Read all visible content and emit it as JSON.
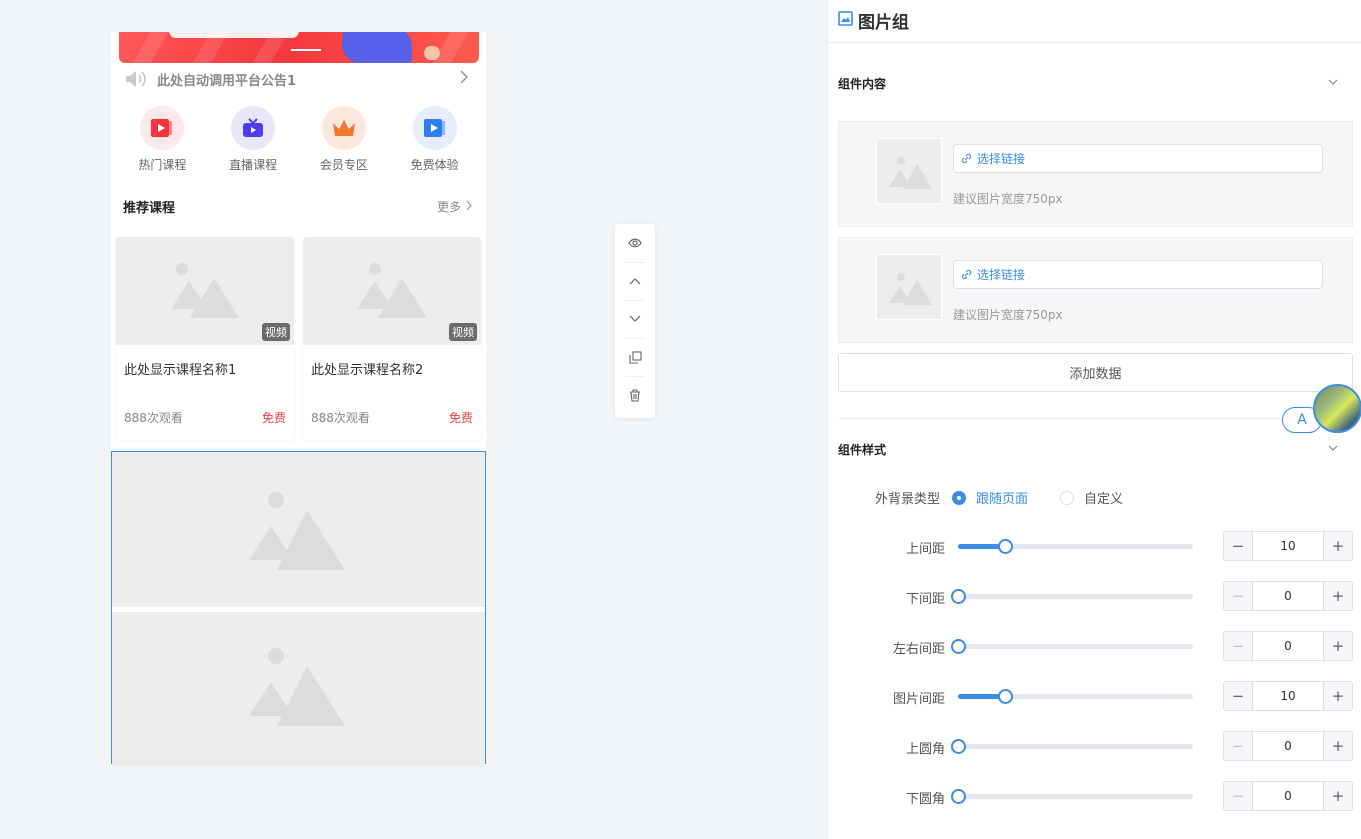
{
  "preview": {
    "notice": {
      "text": "此处自动调用平台公告1"
    },
    "icons": [
      {
        "label": "热门课程",
        "icon": "play-icon",
        "bg": "#fde8ea",
        "color": "#f2333e"
      },
      {
        "label": "直播课程",
        "icon": "tv-icon",
        "bg": "#e8e6fb",
        "color": "#4c3df2"
      },
      {
        "label": "会员专区",
        "icon": "crown-icon",
        "bg": "#fde9dc",
        "color": "#f07a2f"
      },
      {
        "label": "免费体验",
        "icon": "play-icon",
        "bg": "#e4edfb",
        "color": "#2f7ef0"
      }
    ],
    "recommend": {
      "title": "推荐课程",
      "more": "更多"
    },
    "courses": [
      {
        "tag": "视频",
        "name": "此处显示课程名称1",
        "views": "888次观看",
        "price": "免费"
      },
      {
        "tag": "视频",
        "name": "此处显示课程名称2",
        "views": "888次观看",
        "price": "免费"
      }
    ]
  },
  "toolbar": [
    "eye-icon",
    "arrow-up-icon",
    "arrow-down-icon",
    "copy-icon",
    "delete-icon"
  ],
  "panel": {
    "title": "图片组",
    "content_section": "组件内容",
    "images": [
      {
        "link_label": "选择链接",
        "hint": "建议图片宽度750px"
      },
      {
        "link_label": "选择链接",
        "hint": "建议图片宽度750px"
      }
    ],
    "add_label": "添加数据",
    "style_section": "组件样式",
    "bg_type": {
      "label": "外背景类型",
      "options": [
        "跟随页面",
        "自定义"
      ],
      "selected": "跟随页面"
    },
    "fab_label": "A",
    "accent": "#3a8ee6",
    "sliders": [
      {
        "label": "上间距",
        "value": "10",
        "fraction": 0.2
      },
      {
        "label": "下间距",
        "value": "0",
        "fraction": 0
      },
      {
        "label": "左右间距",
        "value": "0",
        "fraction": 0
      },
      {
        "label": "图片间距",
        "value": "10",
        "fraction": 0.2
      },
      {
        "label": "上圆角",
        "value": "0",
        "fraction": 0
      },
      {
        "label": "下圆角",
        "value": "0",
        "fraction": 0
      }
    ]
  }
}
